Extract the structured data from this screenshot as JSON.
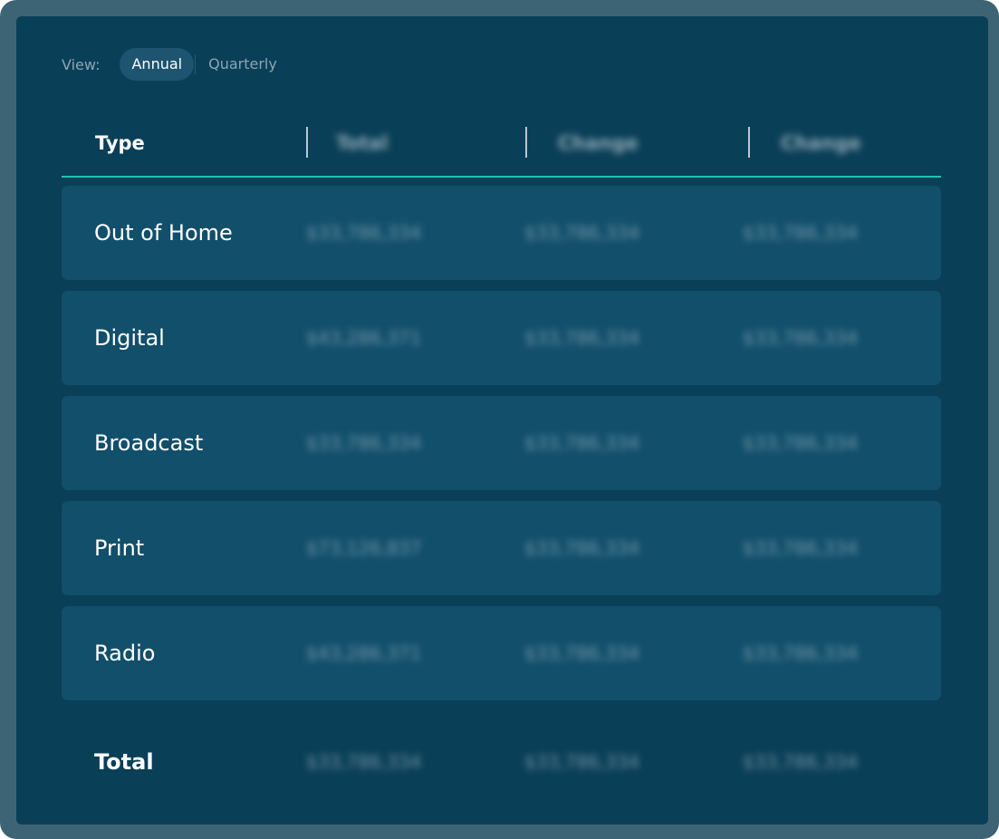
{
  "view": {
    "label": "View:",
    "options": [
      "Annual",
      "Quarterly"
    ],
    "selected": "Annual"
  },
  "table": {
    "headers": [
      "Type",
      "Total",
      "Change",
      "Change"
    ],
    "rows": [
      {
        "type": "Out of Home",
        "values": [
          "$33,786,334",
          "$33,786,334",
          "$33,786,334"
        ]
      },
      {
        "type": "Digital",
        "values": [
          "$43,286,371",
          "$33,786,334",
          "$33,786,334"
        ]
      },
      {
        "type": "Broadcast",
        "values": [
          "$33,786,334",
          "$33,786,334",
          "$33,786,334"
        ]
      },
      {
        "type": "Print",
        "values": [
          "$73,126,837",
          "$33,786,334",
          "$33,786,334"
        ]
      },
      {
        "type": "Radio",
        "values": [
          "$43,286,371",
          "$33,786,334",
          "$33,786,334"
        ]
      }
    ],
    "total": {
      "type": "Total",
      "values": [
        "$33,786,334",
        "$33,786,334",
        "$33,786,334"
      ]
    }
  },
  "colors": {
    "frame": "#3d6475",
    "panel": "#0a3f58",
    "row": "#124f6b",
    "accent": "#1fc4b0"
  }
}
